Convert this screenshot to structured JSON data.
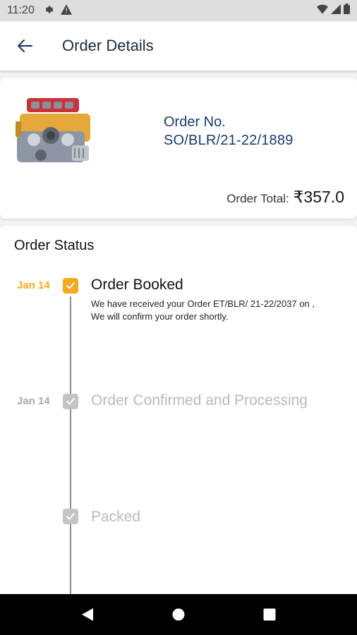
{
  "status_bar": {
    "time": "11:20"
  },
  "app_bar": {
    "title": "Order Details"
  },
  "order": {
    "number_label": "Order No.",
    "number": "SO/BLR/21-22/1889",
    "total_label": "Order Total:",
    "total": "₹357.0"
  },
  "status": {
    "heading": "Order Status",
    "steps": [
      {
        "date": "Jan 14",
        "title": "Order Booked",
        "description": "We have received your Order ET/BLR/ 21-22/2037 on , We will confirm your order shortly.",
        "state": "active"
      },
      {
        "date": "Jan 14",
        "title": "Order Confirmed and Processing",
        "description": "",
        "state": "inactive"
      },
      {
        "date": "",
        "title": "Packed",
        "description": "",
        "state": "inactive"
      }
    ]
  },
  "colors": {
    "active_accent": "#f4a91e",
    "inactive": "#b9b9b9",
    "primary_text": "#173a6b"
  }
}
